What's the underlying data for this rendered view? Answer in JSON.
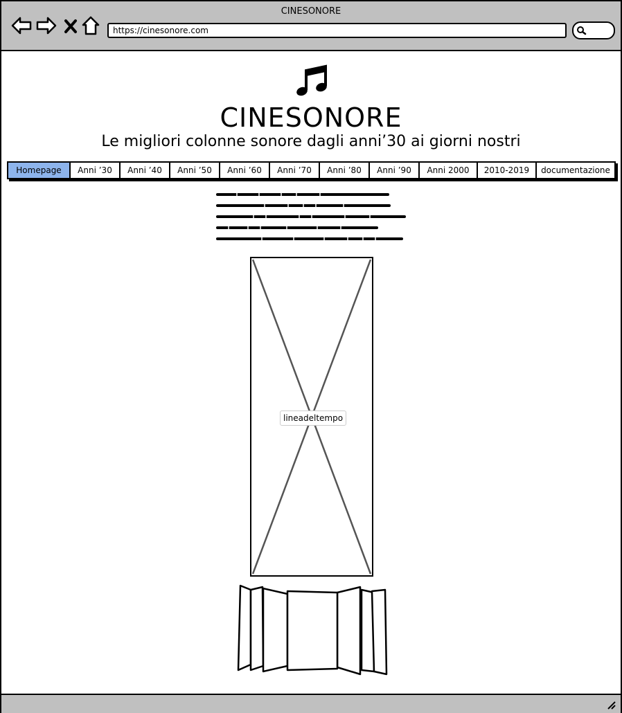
{
  "window": {
    "title": "CINESONORE"
  },
  "toolbar": {
    "address": "https://cinesonore.com",
    "icons": [
      "back-arrow-icon",
      "forward-arrow-icon",
      "close-icon",
      "home-icon",
      "search-icon"
    ]
  },
  "header": {
    "logo_icon": "music-note-icon",
    "title": "CINESONORE",
    "tagline": "Le migliori colonne sonore dagli anni’30 ai giorni nostri"
  },
  "nav": {
    "tabs": [
      {
        "label": "Homepage",
        "active": true
      },
      {
        "label": "Anni ’30"
      },
      {
        "label": "Anni ’40"
      },
      {
        "label": "Anni ’50"
      },
      {
        "label": "Anni ’60"
      },
      {
        "label": "Anni ’70"
      },
      {
        "label": "Anni ’80"
      },
      {
        "label": "Anni ’90"
      },
      {
        "label": "Anni 2000"
      },
      {
        "label": "2010-2019"
      },
      {
        "label": "documentazione"
      }
    ]
  },
  "main": {
    "image_placeholder_label": "lineadeltempo"
  },
  "colors": {
    "active_tab": "#8db4ec",
    "chrome": "#c0c0c0"
  }
}
